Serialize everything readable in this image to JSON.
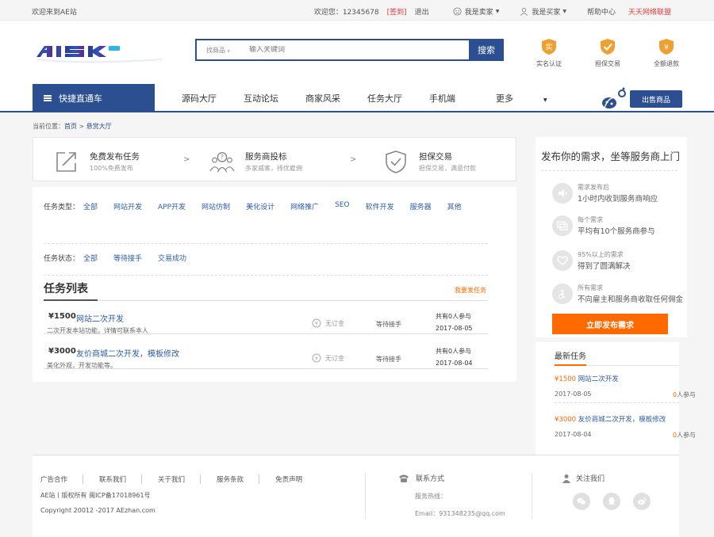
{
  "topbar": {
    "welcome": "欢迎来到AE站",
    "greeting": "欢迎您：",
    "username": "12345678",
    "signin": "[签到]",
    "logout": "退出",
    "seller": "我是卖家",
    "buyer": "我是买家",
    "help": "帮助中心",
    "alliance": "天天网络联盟"
  },
  "header": {
    "search": {
      "category": "找商品",
      "placeholder": "输入关键词",
      "button": "搜索"
    },
    "trust": [
      {
        "label": "实名认证",
        "glyph": "实"
      },
      {
        "label": "担保交易",
        "glyph": "✓"
      },
      {
        "label": "全额退款",
        "glyph": "¥"
      }
    ]
  },
  "nav": {
    "quick": "快捷直通车",
    "links": [
      "源码大厅",
      "互动论坛",
      "商家风采",
      "任务大厅",
      "手机端",
      "更多"
    ],
    "sell_button": "出售商品"
  },
  "breadcrumb": {
    "prefix": "当前位置：",
    "home": "首页",
    "sep": ">",
    "current": "悬赏大厅"
  },
  "steps": [
    {
      "title": "免费发布任务",
      "sub": "100%免费发布"
    },
    {
      "title": "服务商投标",
      "sub": "多家威客，择优雇佣"
    },
    {
      "title": "担保交易",
      "sub": "担保交易，满意付款"
    }
  ],
  "filters": {
    "type_label": "任务类型：",
    "types": [
      "全部",
      "网站开发",
      "APP开发",
      "网站仿制",
      "美化设计",
      "网络推广",
      "SEO",
      "软件开发",
      "服务器",
      "其他"
    ],
    "status_label": "任务状态：",
    "statuses": [
      "全部",
      "等待接手",
      "交易成功"
    ]
  },
  "task_list": {
    "title": "任务列表",
    "publish_link": "我要发任务",
    "tasks": [
      {
        "price": "¥1500",
        "name": "网站二次开发",
        "desc": "二次开发本站功能，详情可联系本人",
        "deposit": "无订金",
        "status": "等待接手",
        "participants": "共有0人参与",
        "date": "2017-08-05"
      },
      {
        "price": "¥3000",
        "name": "友价商城二次开发，模板修改",
        "desc": "美化外观，开发功能等。",
        "deposit": "无订金",
        "status": "等待接手",
        "participants": "共有0人参与",
        "date": "2017-08-04"
      }
    ]
  },
  "sidebar": {
    "headline": "发布你的需求，坐等服务商上门",
    "features": [
      {
        "small": "需求发布后",
        "main": "1小时内收到服务商响应"
      },
      {
        "small": "每个需求",
        "main": "平均有10个服务商参与"
      },
      {
        "small": "95%以上的需求",
        "main": "得到了圆满解决"
      },
      {
        "small": "所有需求",
        "main": "不向雇主和服务商收取任何佣金"
      }
    ],
    "cta": "立即发布需求"
  },
  "latest": {
    "title": "最新任务",
    "items": [
      {
        "price": "¥1500",
        "name": "网站二次开发",
        "date": "2017-08-05",
        "count": "0",
        "suffix": "人参与"
      },
      {
        "price": "¥3000",
        "name": "友价商城二次开发，模板修改",
        "date": "2017-08-04",
        "count": "0",
        "suffix": "人参与"
      }
    ]
  },
  "footer": {
    "links": [
      "广告合作",
      "联系我们",
      "关于我们",
      "服务条款",
      "免责声明"
    ],
    "icp": "AE站丨版权所有 闽ICP备17018961号",
    "copyright": "Copyright 20012 -2017 AEzhan.com",
    "contact_title": "联系方式",
    "hotline": "服务热线：",
    "email": "Email：931348235@qq.com",
    "follow_title": "关注我们"
  },
  "colors": {
    "brand": "#2b4f91",
    "accent": "#ff6a00",
    "link": "#2b5da8",
    "alert": "#e4393c"
  }
}
